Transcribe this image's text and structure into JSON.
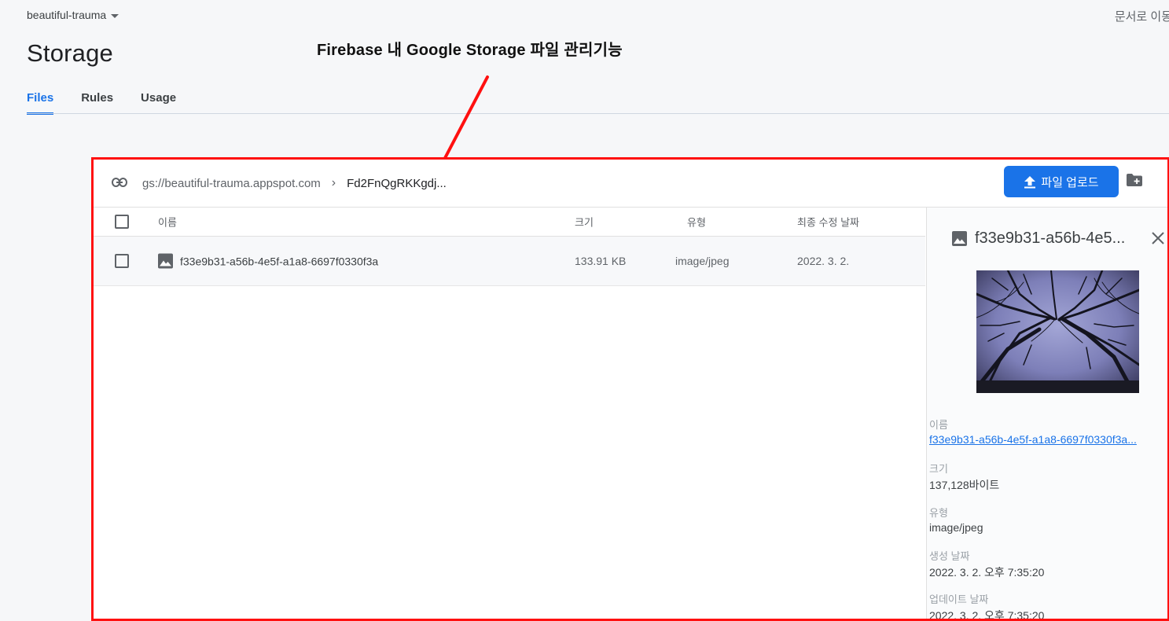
{
  "header": {
    "project_name": "beautiful-trauma",
    "docs_link": "문서로 이동",
    "page_title": "Storage",
    "annotation": "Firebase 내 Google Storage 파일 관리기능"
  },
  "tabs": [
    {
      "label": "Files"
    },
    {
      "label": "Rules"
    },
    {
      "label": "Usage"
    }
  ],
  "toolbar": {
    "bucket_path": "gs://beautiful-trauma.appspot.com",
    "current_folder": "Fd2FnQgRKKgdj...",
    "upload_label": "파일 업로드"
  },
  "list": {
    "columns": [
      "이름",
      "크기",
      "유형",
      "최종 수정 날짜"
    ],
    "rows": [
      {
        "name": "f33e9b31-a56b-4e5f-a1a8-6697f0330f3a",
        "size": "133.91 KB",
        "type": "image/jpeg",
        "modified": "2022. 3. 2."
      }
    ]
  },
  "details": {
    "title": "f33e9b31-a56b-4e5...",
    "fields": [
      {
        "label": "이름",
        "value": "f33e9b31-a56b-4e5f-a1a8-6697f0330f3a..."
      },
      {
        "label": "크기",
        "value": "137,128바이트"
      },
      {
        "label": "유형",
        "value": "image/jpeg"
      },
      {
        "label": "생성 날짜",
        "value": "2022. 3. 2. 오후 7:35:20"
      },
      {
        "label": "업데이트 날짜",
        "value": "2022. 3. 2. 오후 7:35:20"
      }
    ]
  },
  "colors": {
    "accent": "#1a73e8",
    "highlight_border": "#ff1010"
  }
}
